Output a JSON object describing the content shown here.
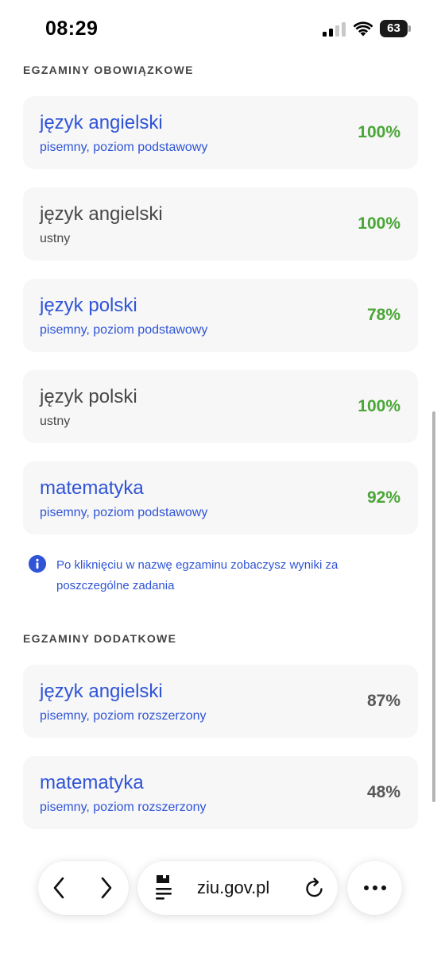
{
  "status_bar": {
    "time": "08:29",
    "battery": "63"
  },
  "sections": {
    "mandatory_title": "EGZAMINY OBOWIĄZKOWE",
    "additional_title": "EGZAMINY DODATKOWE"
  },
  "mandatory_exams": [
    {
      "title": "język angielski",
      "subtitle": "pisemny, poziom podstawowy",
      "score": "100%"
    },
    {
      "title": "język angielski",
      "subtitle": "ustny",
      "score": "100%"
    },
    {
      "title": "język polski",
      "subtitle": "pisemny, poziom podstawowy",
      "score": "78%"
    },
    {
      "title": "język polski",
      "subtitle": "ustny",
      "score": "100%"
    },
    {
      "title": "matematyka",
      "subtitle": "pisemny, poziom podstawowy",
      "score": "92%"
    }
  ],
  "info_note": "Po kliknięciu w nazwę egzaminu zobaczysz wyniki za poszczególne zadania",
  "additional_exams": [
    {
      "title": "język angielski",
      "subtitle": "pisemny, poziom rozszerzony",
      "score": "87%"
    },
    {
      "title": "matematyka",
      "subtitle": "pisemny, poziom rozszerzony",
      "score": "48%"
    }
  ],
  "browser": {
    "url": "ziu.gov.pl"
  },
  "colors": {
    "link_blue": "#2f54d6",
    "score_green": "#4aa637",
    "score_gray": "#575757",
    "card_bg": "#f7f7f7"
  },
  "icons": [
    "signal-icon",
    "wifi-icon",
    "battery-icon",
    "info-icon",
    "back-arrow-icon",
    "forward-arrow-icon",
    "page-settings-icon",
    "reload-icon",
    "more-icon"
  ]
}
